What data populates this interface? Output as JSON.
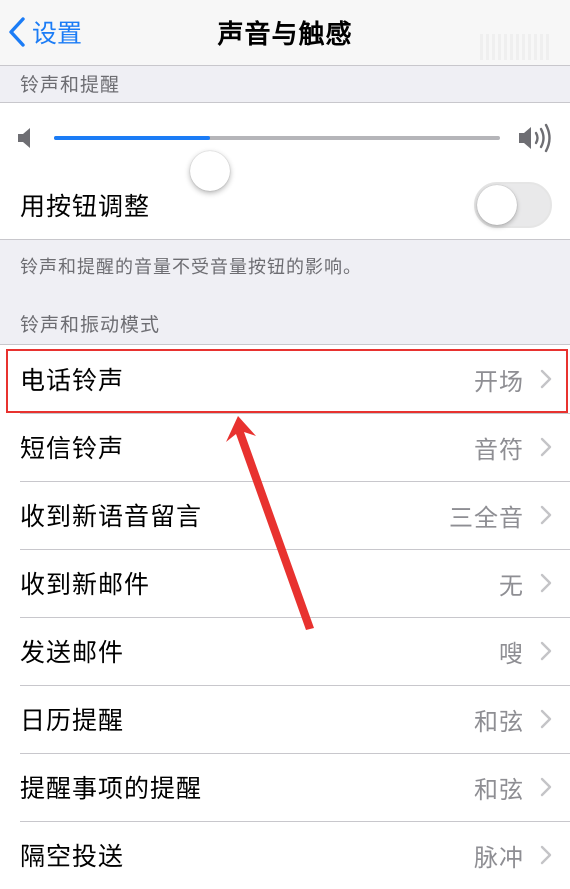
{
  "nav": {
    "back_label": "设置",
    "title": "声音与触感"
  },
  "ringtones_alerts": {
    "header": "铃声和提醒",
    "volume_level": 0.35,
    "change_with_buttons_label": "用按钮调整",
    "change_with_buttons_on": false,
    "footer": "铃声和提醒的音量不受音量按钮的影响。"
  },
  "patterns": {
    "header": "铃声和振动模式",
    "items": [
      {
        "label": "电话铃声",
        "value": "开场"
      },
      {
        "label": "短信铃声",
        "value": "音符"
      },
      {
        "label": "收到新语音留言",
        "value": "三全音"
      },
      {
        "label": "收到新邮件",
        "value": "无"
      },
      {
        "label": "发送邮件",
        "value": "嗖"
      },
      {
        "label": "日历提醒",
        "value": "和弦"
      },
      {
        "label": "提醒事项的提醒",
        "value": "和弦"
      },
      {
        "label": "隔空投送",
        "value": "脉冲"
      }
    ]
  },
  "colors": {
    "accent": "#1b7cf6",
    "highlight": "#e8322f"
  }
}
